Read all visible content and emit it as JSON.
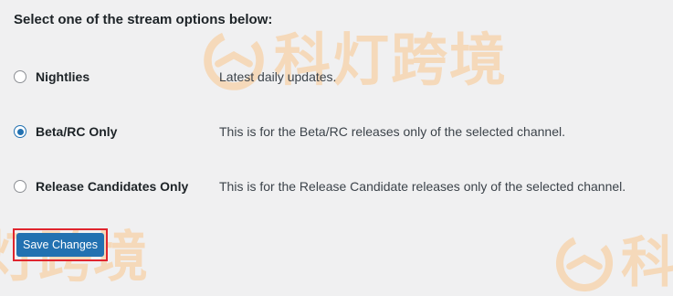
{
  "heading": "Select one of the stream options below:",
  "options": [
    {
      "label": "Nightlies",
      "description": "Latest daily updates.",
      "checked": false
    },
    {
      "label": "Beta/RC Only",
      "description": "This is for the Beta/RC releases only of the selected channel.",
      "checked": true
    },
    {
      "label": "Release Candidates Only",
      "description": "This is for the Release Candidate releases only of the selected channel.",
      "checked": false
    }
  ],
  "save_button": {
    "label": "Save Changes"
  },
  "watermark": {
    "main_text": "科灯跨境",
    "bottom_left_text": "灯跨境",
    "bottom_right_text": "科"
  },
  "colors": {
    "accent": "#2271b1",
    "highlight_border": "#e0252e",
    "watermark": "#f6d7b5",
    "background": "#f0f0f1"
  }
}
